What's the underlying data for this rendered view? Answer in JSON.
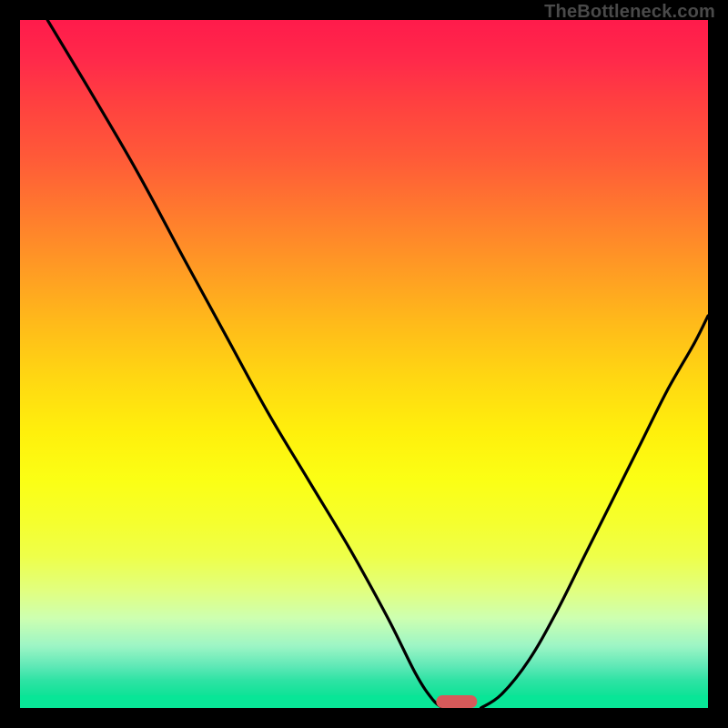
{
  "watermark": "TheBottleneck.com",
  "colors": {
    "background": "#000000",
    "marker": "#d65a5a",
    "curve_stroke": "#000000"
  },
  "chart_data": {
    "type": "line",
    "title": "",
    "xlabel": "",
    "ylabel": "",
    "xlim": [
      0,
      100
    ],
    "ylim": [
      0,
      100
    ],
    "grid": false,
    "legend": false,
    "series": [
      {
        "name": "bottleneck-curve-left",
        "x": [
          4,
          10,
          17,
          24,
          30,
          36,
          42,
          48,
          53.5,
          57.5,
          60,
          61.5
        ],
        "values": [
          100,
          90,
          78,
          65,
          54,
          43,
          33,
          23,
          13,
          5,
          1.2,
          0
        ]
      },
      {
        "name": "bottleneck-curve-right",
        "x": [
          67,
          70,
          74,
          78,
          82,
          86,
          90,
          94,
          98,
          100
        ],
        "values": [
          0,
          2,
          7,
          14,
          22,
          30,
          38,
          46,
          53,
          57
        ]
      }
    ],
    "marker": {
      "x_range": [
        60.5,
        66.5
      ],
      "y": 0,
      "label": ""
    },
    "gradient": {
      "orientation": "vertical",
      "stops": [
        {
          "pct": 0,
          "color": "#ff1b4b"
        },
        {
          "pct": 20,
          "color": "#ff5a38"
        },
        {
          "pct": 40,
          "color": "#ffba1a"
        },
        {
          "pct": 60,
          "color": "#fff00c"
        },
        {
          "pct": 80,
          "color": "#e1ff80"
        },
        {
          "pct": 96,
          "color": "#2ee3a4"
        },
        {
          "pct": 100,
          "color": "#08e696"
        }
      ]
    }
  }
}
